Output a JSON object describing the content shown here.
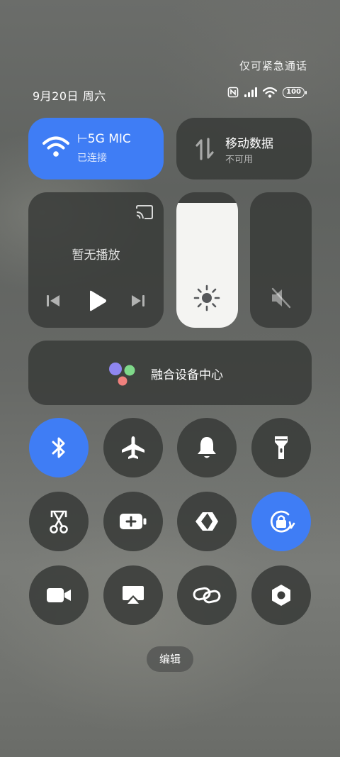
{
  "status_bar": {
    "emergency_text": "仅可紧急通话",
    "date_text": "9月20日 周六",
    "battery_level": "100",
    "icons": [
      "nfc-icon",
      "signal-icon",
      "wifi-icon",
      "battery-icon"
    ]
  },
  "tiles": {
    "wifi": {
      "title": "⊢5G    MIC",
      "status": "已连接",
      "active": true,
      "color": "#3f7df5"
    },
    "mobile_data": {
      "title": "移动数据",
      "status": "不可用",
      "active": false
    },
    "media": {
      "status": "暂无播放",
      "icons": [
        "cast-icon",
        "previous-icon",
        "play-icon",
        "next-icon"
      ]
    },
    "brightness": {
      "level_percent": 92
    },
    "volume": {
      "muted": true
    },
    "device_hub": {
      "label": "融合设备中心"
    }
  },
  "toggles": [
    {
      "icon": "bluetooth-icon",
      "active": true
    },
    {
      "icon": "airplane-icon",
      "active": false
    },
    {
      "icon": "bell-icon",
      "active": false
    },
    {
      "icon": "flashlight-icon",
      "active": false
    },
    {
      "icon": "screenshot-icon",
      "active": false
    },
    {
      "icon": "battery-saver-icon",
      "active": false
    },
    {
      "icon": "nearby-share-icon",
      "active": false
    },
    {
      "icon": "rotation-lock-icon",
      "active": true
    },
    {
      "icon": "screen-record-icon",
      "active": false
    },
    {
      "icon": "cast-screen-icon",
      "active": false
    },
    {
      "icon": "link-icon",
      "active": false
    },
    {
      "icon": "settings-nut-icon",
      "active": false
    }
  ],
  "edit_label": "编辑",
  "colors": {
    "accent": "#3f7df5",
    "tile_dark": "#373937"
  }
}
